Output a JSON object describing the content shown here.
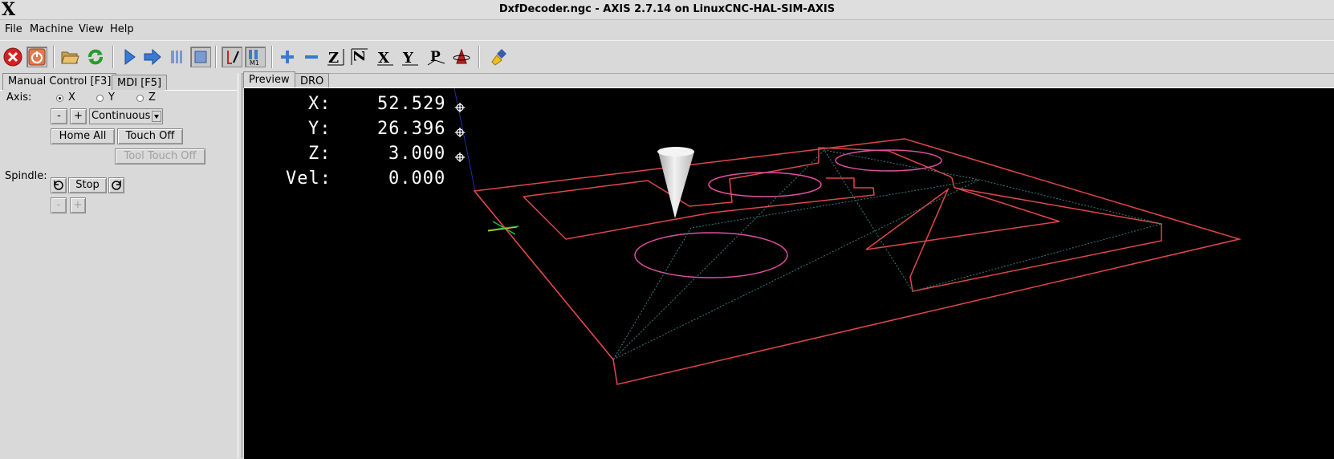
{
  "window": {
    "title": "DxfDecoder.ngc - AXIS 2.7.14 on LinuxCNC-HAL-SIM-AXIS",
    "logo": "X"
  },
  "menu": [
    "File",
    "Machine",
    "View",
    "Help"
  ],
  "toolbar": {
    "icons": [
      "estop-icon",
      "power-icon",
      "open-icon",
      "reload-icon",
      "run-icon",
      "step-icon",
      "pause-icon",
      "stop-icon",
      "block-delete-icon",
      "optional-stop-icon",
      "zoom-in-icon",
      "zoom-out-icon",
      "view-z-icon",
      "view-z2-icon",
      "view-x-icon",
      "view-y-icon",
      "view-p-icon",
      "rotate-icon",
      "clear-plot-icon"
    ]
  },
  "left_tabs": [
    "Manual Control [F3]",
    "MDI [F5]"
  ],
  "manual": {
    "axis_label": "Axis:",
    "axes": [
      "X",
      "Y",
      "Z"
    ],
    "selected_axis": "X",
    "minus": "-",
    "plus": "+",
    "jog_mode": "Continuous",
    "home_all": "Home All",
    "touch_off": "Touch Off",
    "tool_touch_off": "Tool Touch Off",
    "spindle_label": "Spindle:",
    "spindle_stop": "Stop",
    "spindle_minus": "-",
    "spindle_plus": "+"
  },
  "right_tabs": [
    "Preview",
    "DRO"
  ],
  "dro": {
    "x_label": "X:",
    "x_value": "52.529",
    "y_label": "Y:",
    "y_value": "26.396",
    "z_label": "Z:",
    "z_value": "3.000",
    "vel_label": "Vel:",
    "vel_value": "0.000"
  },
  "colors": {
    "preview_bg": "#000000",
    "toolpath_feed": "#e0464a",
    "arc": "#e050a0",
    "rapid": "#3a7e7e",
    "tool": "#e8e8e8"
  }
}
